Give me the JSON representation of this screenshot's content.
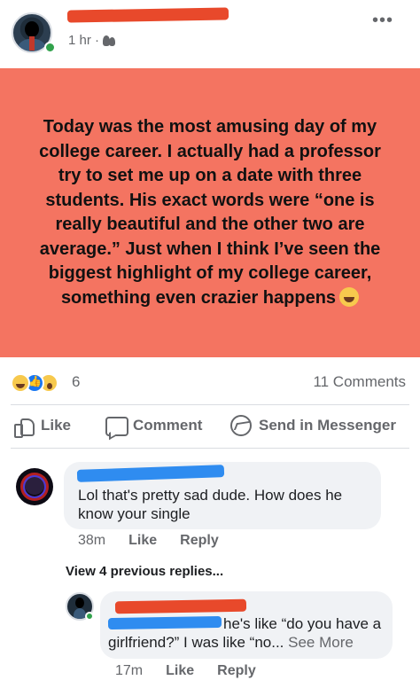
{
  "post": {
    "time": "1 hr ·",
    "privacy_icon": "friends-icon",
    "more_icon": "more-horizontal-icon",
    "background_color": "#f47461",
    "text": "Today was the most amusing day of my college career. I actually had a professor try to set me up on a date with three students. His exact words were “one is really beautiful and the other two are average.” Just when I think I’ve seen the biggest highlight of my college career, something even crazier happens",
    "emoji": "laughing-emoji"
  },
  "reactions": {
    "icons": [
      "haha",
      "like",
      "wow"
    ],
    "count": "6",
    "comments": "11 Comments"
  },
  "actions": {
    "like": "Like",
    "comment": "Comment",
    "messenger": "Send in Messenger"
  },
  "comments": [
    {
      "text": "Lol that's pretty sad dude. How does he know your single",
      "time": "38m",
      "like": "Like",
      "reply": "Reply"
    },
    {
      "text_line1": "he's like “do you have a",
      "text_line2": "girlfriend?” I was like “no...",
      "see_more": "See More",
      "time": "17m",
      "like": "Like",
      "reply": "Reply"
    }
  ],
  "view_replies": "View 4 previous replies..."
}
